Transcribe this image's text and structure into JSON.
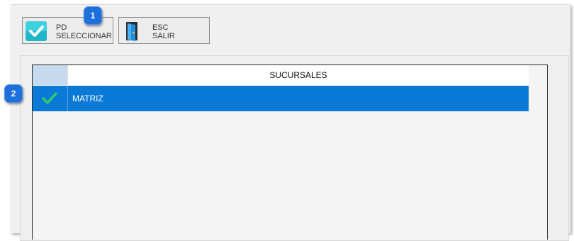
{
  "toolbar": {
    "select": {
      "key": "PD",
      "label": "SELECCIONAR",
      "icon": "select-check-icon"
    },
    "exit": {
      "key": "ESC",
      "label": "SALIR",
      "icon": "exit-door-icon"
    }
  },
  "callouts": {
    "one": "1",
    "two": "2"
  },
  "grid": {
    "header": "SUCURSALES",
    "rows": [
      {
        "checked": true,
        "name": "MATRIZ",
        "selected": true
      }
    ]
  },
  "colors": {
    "selection": "#0a7ad6",
    "check": "#2ecc71",
    "badge": "#1e6fd9"
  }
}
